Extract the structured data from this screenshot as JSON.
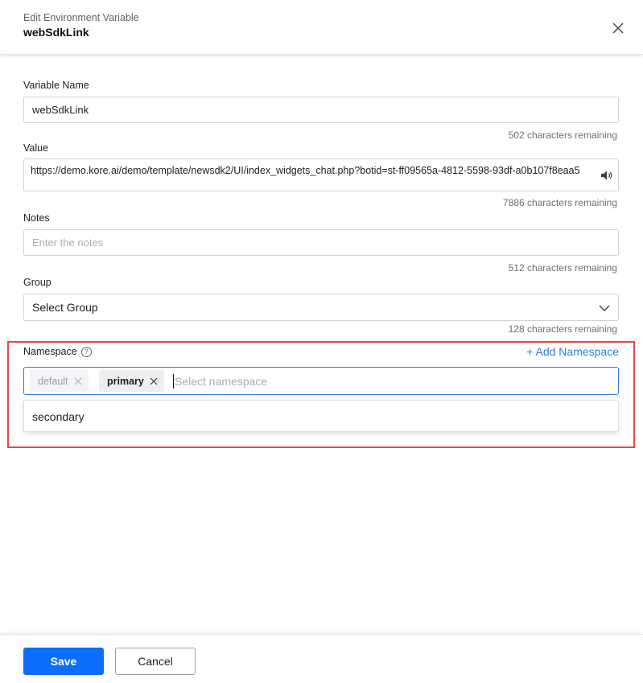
{
  "header": {
    "subtitle": "Edit Environment Variable",
    "title": "webSdkLink",
    "close_icon": "close-icon"
  },
  "form": {
    "variable_name": {
      "label": "Variable Name",
      "value": "webSdkLink",
      "helper": "502 characters remaining"
    },
    "value": {
      "label": "Value",
      "value": "https://demo.kore.ai/demo/template/newsdk2/UI/index_widgets_chat.php?botid=st-ff09565a-4812-5598-93df-a0b107f8eaa5",
      "helper": "7886 characters remaining",
      "icon": "speaker-icon"
    },
    "notes": {
      "label": "Notes",
      "placeholder": "Enter the notes",
      "helper": "512 characters remaining"
    },
    "group": {
      "label": "Group",
      "selected": "Select Group",
      "helper": "128 characters remaining"
    },
    "namespace": {
      "label": "Namespace",
      "help_icon": "question-circle-icon",
      "add_label": "+ Add Namespace",
      "chips": [
        {
          "label": "default"
        },
        {
          "label": "primary"
        }
      ],
      "placeholder": "Select namespace",
      "options": [
        "secondary"
      ]
    }
  },
  "footer": {
    "save_label": "Save",
    "cancel_label": "Cancel"
  },
  "colors": {
    "accent": "#0d6efd",
    "link": "#2c7be5",
    "highlight": "#e5484d"
  }
}
